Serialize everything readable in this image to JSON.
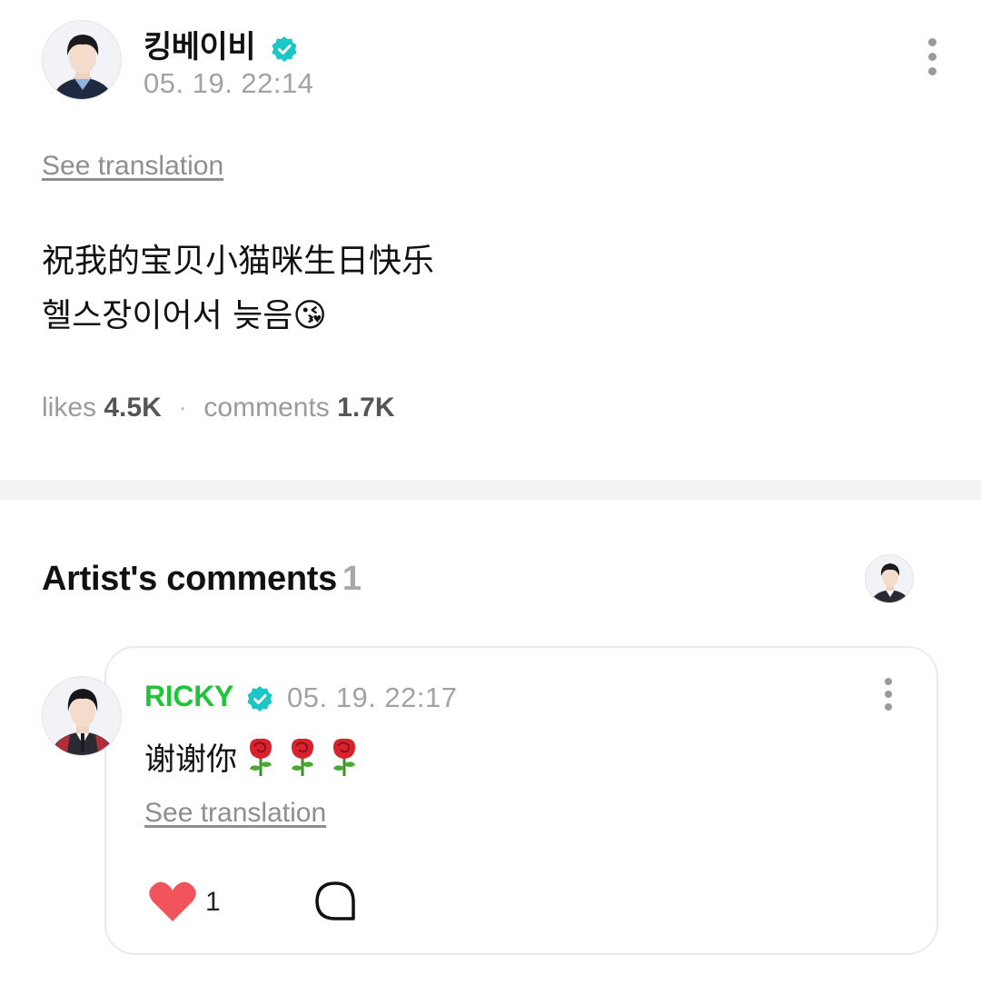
{
  "post": {
    "author": "킹베이비",
    "date": "05. 19. 22:14",
    "see_translation": "See translation",
    "body_line1": "祝我的宝贝小猫咪生日快乐",
    "body_line2": "헬스장이어서 늦음",
    "body_emoji": "😘",
    "likes_label": "likes",
    "likes_value": "4.5K",
    "comments_label": "comments",
    "comments_value": "1.7K"
  },
  "artist_comments": {
    "title": "Artist's comments",
    "count": "1"
  },
  "comment": {
    "author": "RICKY",
    "date": "05. 19. 22:17",
    "text": "谢谢你",
    "see_translation": "See translation",
    "like_count": "1",
    "emoji_count": 3
  },
  "icons": {
    "verified": "verified-badge-icon",
    "more": "more-vertical-icon",
    "heart": "heart-icon",
    "reply": "comment-bubble-icon",
    "rose": "rose-emoji"
  },
  "colors": {
    "accent_green": "#1fc43a",
    "verified_teal": "#1cc6c6",
    "heart_red": "#f2545b",
    "muted_gray": "#a2a2a2"
  }
}
